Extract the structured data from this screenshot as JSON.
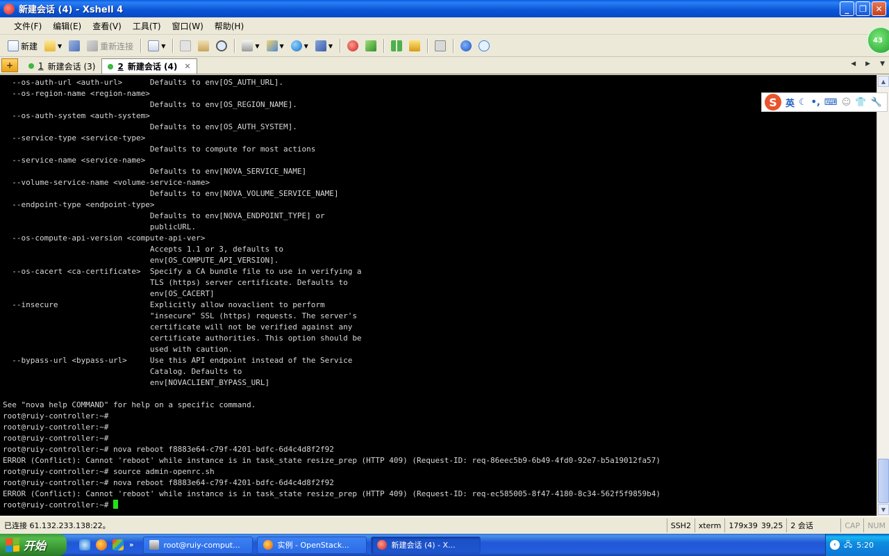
{
  "window": {
    "title": "新建会话 (4) - Xshell 4"
  },
  "menu": [
    {
      "label": "文件(F)"
    },
    {
      "label": "编辑(E)"
    },
    {
      "label": "查看(V)"
    },
    {
      "label": "工具(T)"
    },
    {
      "label": "窗口(W)"
    },
    {
      "label": "帮助(H)"
    }
  ],
  "toolbar": {
    "new_label": "新建",
    "reconnect_label": "重新连接"
  },
  "tray_badge": "43",
  "tabs": [
    {
      "number": "1",
      "label": "新建会话 (3)"
    },
    {
      "number": "2",
      "label": "新建会话 (4)"
    }
  ],
  "ime": {
    "mode": "英",
    "logo": "S"
  },
  "terminal": {
    "lines": [
      "  --os-auth-url <auth-url>      Defaults to env[OS_AUTH_URL].",
      "  --os-region-name <region-name>",
      "                                Defaults to env[OS_REGION_NAME].",
      "  --os-auth-system <auth-system>",
      "                                Defaults to env[OS_AUTH_SYSTEM].",
      "  --service-type <service-type>",
      "                                Defaults to compute for most actions",
      "  --service-name <service-name>",
      "                                Defaults to env[NOVA_SERVICE_NAME]",
      "  --volume-service-name <volume-service-name>",
      "                                Defaults to env[NOVA_VOLUME_SERVICE_NAME]",
      "  --endpoint-type <endpoint-type>",
      "                                Defaults to env[NOVA_ENDPOINT_TYPE] or",
      "                                publicURL.",
      "  --os-compute-api-version <compute-api-ver>",
      "                                Accepts 1.1 or 3, defaults to",
      "                                env[OS_COMPUTE_API_VERSION].",
      "  --os-cacert <ca-certificate>  Specify a CA bundle file to use in verifying a",
      "                                TLS (https) server certificate. Defaults to",
      "                                env[OS_CACERT]",
      "  --insecure                    Explicitly allow novaclient to perform",
      "                                \"insecure\" SSL (https) requests. The server's",
      "                                certificate will not be verified against any",
      "                                certificate authorities. This option should be",
      "                                used with caution.",
      "  --bypass-url <bypass-url>     Use this API endpoint instead of the Service",
      "                                Catalog. Defaults to",
      "                                env[NOVACLIENT_BYPASS_URL]",
      "",
      "See \"nova help COMMAND\" for help on a specific command.",
      "root@ruiy-controller:~#",
      "root@ruiy-controller:~#",
      "root@ruiy-controller:~#",
      "root@ruiy-controller:~# nova reboot f8883e64-c79f-4201-bdfc-6d4c4d8f2f92",
      "ERROR (Conflict): Cannot 'reboot' while instance is in task_state resize_prep (HTTP 409) (Request-ID: req-86eec5b9-6b49-4fd0-92e7-b5a19012fa57)",
      "root@ruiy-controller:~# source admin-openrc.sh",
      "root@ruiy-controller:~# nova reboot f8883e64-c79f-4201-bdfc-6d4c4d8f2f92",
      "ERROR (Conflict): Cannot 'reboot' while instance is in task_state resize_prep (HTTP 409) (Request-ID: req-ec585005-8f47-4180-8c34-562f5f9859b4)"
    ],
    "prompt": "root@ruiy-controller:~# "
  },
  "status": {
    "connection": "已连接 61.132.233.138:22。",
    "protocol": "SSH2",
    "term": "xterm",
    "size": "179x39",
    "cursor_pos": "39,25",
    "sessions": "2 会话",
    "caps": "CAP",
    "num": "NUM"
  },
  "taskbar": {
    "start_label": "开始",
    "tasks": [
      {
        "label": "root@ruiy-comput..."
      },
      {
        "label": "实例 - OpenStack..."
      },
      {
        "label": "新建会话 (4) - X..."
      }
    ],
    "clock": "5:20"
  }
}
